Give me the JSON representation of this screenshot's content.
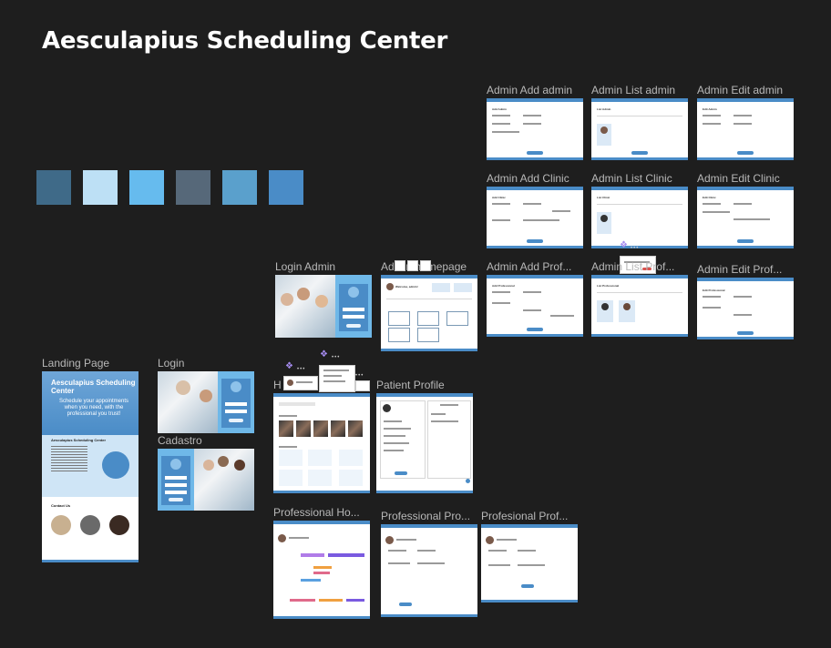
{
  "canvas": {
    "title": "Aesculapius Scheduling Center"
  },
  "palette": {
    "swatches": [
      {
        "color": "#3f6a88"
      },
      {
        "color": "#bde0f5"
      },
      {
        "color": "#66bbee"
      },
      {
        "color": "#566879"
      },
      {
        "color": "#5aa0cc"
      },
      {
        "color": "#4a8cc7"
      }
    ]
  },
  "frames": {
    "admin_add_admin": "Admin Add admin",
    "admin_list_admin": "Admin List admin",
    "admin_edit_admin": "Admin Edit admin",
    "admin_add_clinic": "Admin Add Clinic",
    "admin_list_clinic": "Admin List Clinic",
    "admin_edit_clinic": "Admin Edit Clinic",
    "login_admin": "Login Admin",
    "admin_homepage": "Admin homepage",
    "admin_add_prof": "Admin Add Prof...",
    "admin_list_prof": "Admin List Prof...",
    "admin_edit_prof": "Admin Edit Prof...",
    "landing_page": "Landing Page",
    "login": "Login",
    "cadastro": "Cadastro",
    "home": "H",
    "patient_profile": "Patient Profile",
    "professional_home": "Professional Ho...",
    "professional_pro": "Professional Pro...",
    "profesional_prof": "Profesional Prof..."
  },
  "landing": {
    "hero_title": "Aesculapius Scheduling Center",
    "hero_subtitle": "Schedule your appointments when you need, with the professional you trust!",
    "about_title": "Aesculapius Scheduling Center",
    "contact_title": "Contact Us"
  },
  "mini_texts": {
    "admin_add_heading": "Add Admin",
    "admin_list_heading": "List Admin",
    "admin_edit_heading": "Edit Admin",
    "clinic_add_heading": "Add Clinic",
    "clinic_list_heading": "List Clinic",
    "clinic_edit_heading": "Edit Clinic",
    "prof_add_heading": "Add Professional",
    "prof_list_heading": "List Professional",
    "prof_edit_heading": "Edit Professional",
    "welcome_admin": "Welcome, admin!",
    "login_admin_title": "LOGIN AS ADMIN",
    "login_title": "LOGIN",
    "cadastro_title": "REGISTER"
  }
}
